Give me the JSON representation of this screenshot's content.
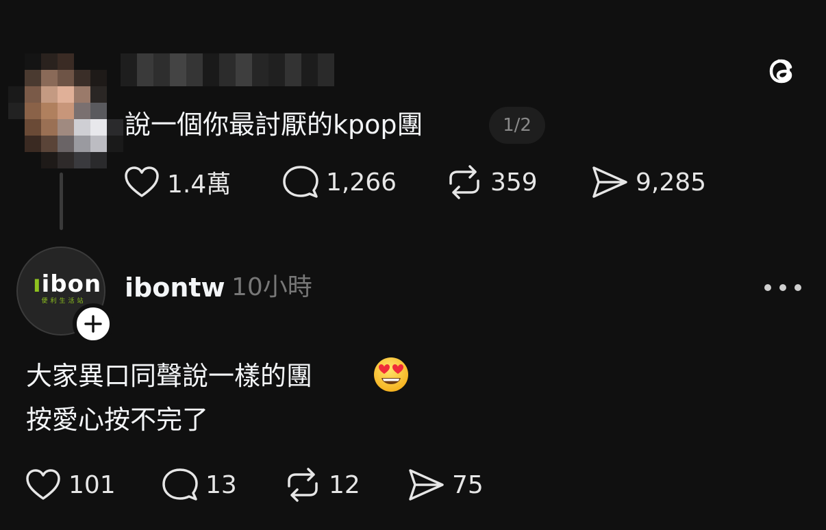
{
  "original_post": {
    "author_name": "",
    "text": "說一個你最討厭的kpop團",
    "page_indicator": "1/2",
    "stats": {
      "likes": "1.4萬",
      "replies": "1,266",
      "reposts": "359",
      "shares": "9,285"
    }
  },
  "app_logo_icon": "threads-logo-icon",
  "reply": {
    "avatar_brand": "ibon",
    "avatar_tagline": "便利生活站",
    "username": "ibontw",
    "time": "10小時",
    "line1": "大家異口同聲說一樣的團",
    "emoji": "smiling-face-with-heart-eyes-emoji",
    "line2": "按愛心按不完了",
    "stats": {
      "likes": "101",
      "replies": "13",
      "reposts": "12",
      "shares": "75"
    }
  },
  "colors": {
    "background": "#101010",
    "text": "#f3f5f7",
    "muted": "#777777",
    "ibon_green": "#8fc31f"
  }
}
